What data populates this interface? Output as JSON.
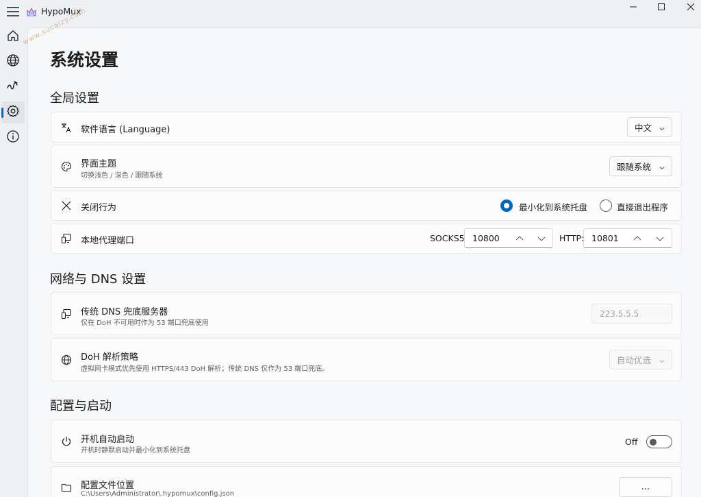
{
  "app": {
    "title": "HypoMux"
  },
  "watermark": "www.sucaizy.com",
  "window_controls": [
    "minimize",
    "maximize",
    "close"
  ],
  "nav": [
    {
      "name": "home-icon",
      "active": false
    },
    {
      "name": "globe-icon",
      "active": false
    },
    {
      "name": "speed-icon",
      "active": false
    },
    {
      "name": "gear-icon",
      "active": true
    },
    {
      "name": "info-icon",
      "active": false
    }
  ],
  "page": {
    "title": "系统设置"
  },
  "sections": {
    "global": "全局设置",
    "network": "网络与 DNS 设置",
    "config": "配置与启动"
  },
  "settings": {
    "language": {
      "title": "软件语言 (Language)",
      "value": "中文"
    },
    "theme": {
      "title": "界面主题",
      "desc": "切换浅色 / 深色 / 跟随系统",
      "value": "跟随系统"
    },
    "close": {
      "title": "关闭行为",
      "option1": "最小化到系统托盘",
      "option2": "直接退出程序",
      "selected": "option1"
    },
    "ports": {
      "title": "本地代理端口",
      "socks_label": "SOCKS5:",
      "socks_value": "10800",
      "http_label": "HTTP:",
      "http_value": "10801"
    },
    "dns": {
      "title": "传统 DNS 兜底服务器",
      "desc": "仅在 DoH 不可用时作为 53 端口兜底使用",
      "placeholder": "223.5.5.5"
    },
    "doh": {
      "title": "DoH 解析策略",
      "desc": "虚拟网卡模式优先使用 HTTPS/443 DoH 解析；传统 DNS 仅作为 53 端口兜底。",
      "value": "自动优选"
    },
    "autostart": {
      "title": "开机自动启动",
      "desc": "开机时静默启动并最小化到系统托盘",
      "state_label": "Off",
      "enabled": false
    },
    "config_path": {
      "title": "配置文件位置",
      "desc": "C:\\Users\\Administrator\\.hypomux\\config.json",
      "button": "..."
    }
  },
  "colors": {
    "accent": "#0067c0",
    "background": "#f7f8fa",
    "card": "#fcfcfd"
  }
}
